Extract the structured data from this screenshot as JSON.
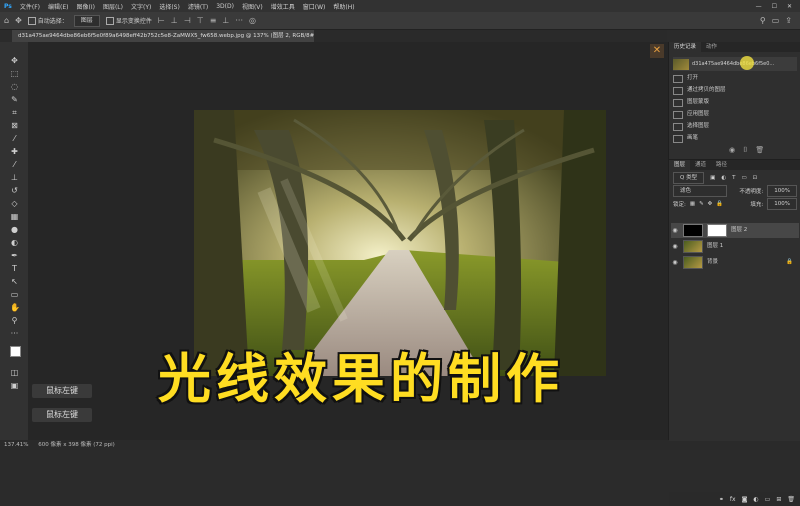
{
  "menu": {
    "items": [
      "文件(F)",
      "编辑(E)",
      "图像(I)",
      "图层(L)",
      "文字(Y)",
      "选择(S)",
      "滤镜(T)",
      "3D(D)",
      "视图(V)",
      "增效工具",
      "窗口(W)",
      "帮助(H)"
    ],
    "win_min": "—",
    "win_max": "☐",
    "win_close": "✕"
  },
  "options": {
    "auto_select_label": "自动选择：",
    "auto_select_value": "图层",
    "show_transform_label": "显示变换控件"
  },
  "document": {
    "tab_title": "d31a475ae9464dbe86eb6f5e0f89a6498eff42b752c5e8-ZaMWX5_fw658.webp.jpg @ 137% (图层 2, RGB/8#) *"
  },
  "caption": {
    "text": "光线效果的制作"
  },
  "keys": {
    "key1": "鼠标左键",
    "key2": "鼠标左键"
  },
  "status": {
    "zoom": "137.41%",
    "doc_size": "600 像素 x 398 像素 (72 ppi)"
  },
  "history_panel": {
    "tabs": [
      "历史记录",
      "动作"
    ],
    "source": "d31a475ae9464dbe86eb6f5e0...",
    "items": [
      "打开",
      "通过拷贝的图层",
      "图层蒙版",
      "应用图层",
      "选择图层",
      "画笔"
    ]
  },
  "layers_panel": {
    "tabs": [
      "图层",
      "通道",
      "路径"
    ],
    "kind_label": "Q 类型",
    "blend_mode": "滤色",
    "opacity_label": "不透明度:",
    "opacity_value": "100%",
    "lock_label": "锁定:",
    "fill_label": "填充:",
    "fill_value": "100%",
    "layers": [
      {
        "name": "图层 2"
      },
      {
        "name": "图层 1"
      },
      {
        "name": "背景"
      }
    ]
  },
  "colors": {
    "caption": "#ffdd22",
    "accent": "#e8a040"
  }
}
